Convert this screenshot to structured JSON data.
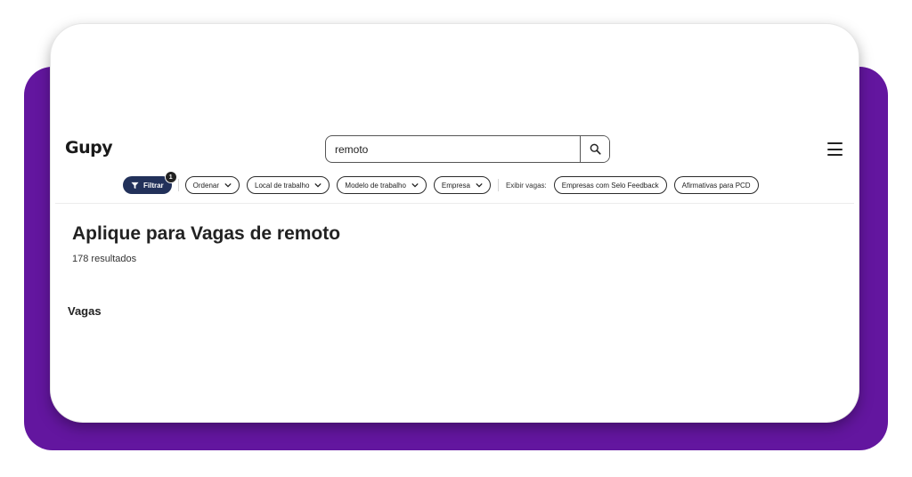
{
  "header": {
    "logo": "Gupy",
    "search": {
      "value": "remoto",
      "button_icon": "search-icon"
    },
    "menu_icon": "hamburger-menu-icon"
  },
  "filters": {
    "filter_button": {
      "label": "Filtrar",
      "count": "1",
      "icon": "funnel-icon"
    },
    "dropdowns": [
      {
        "label": "Ordenar"
      },
      {
        "label": "Local de trabalho"
      },
      {
        "label": "Modelo de trabalho"
      },
      {
        "label": "Empresa"
      }
    ],
    "exibir_label": "Exibir vagas:",
    "toggles": [
      {
        "label": "Empresas com Selo Feedback"
      },
      {
        "label": "Afirmativas para PCD"
      }
    ]
  },
  "main": {
    "title": "Aplique para Vagas de remoto",
    "results_count": "178 resultados",
    "section_title": "Vagas"
  },
  "colors": {
    "backdrop": "#63169f",
    "filter_button_bg": "#22315a",
    "card_bg": "#ffffff"
  }
}
